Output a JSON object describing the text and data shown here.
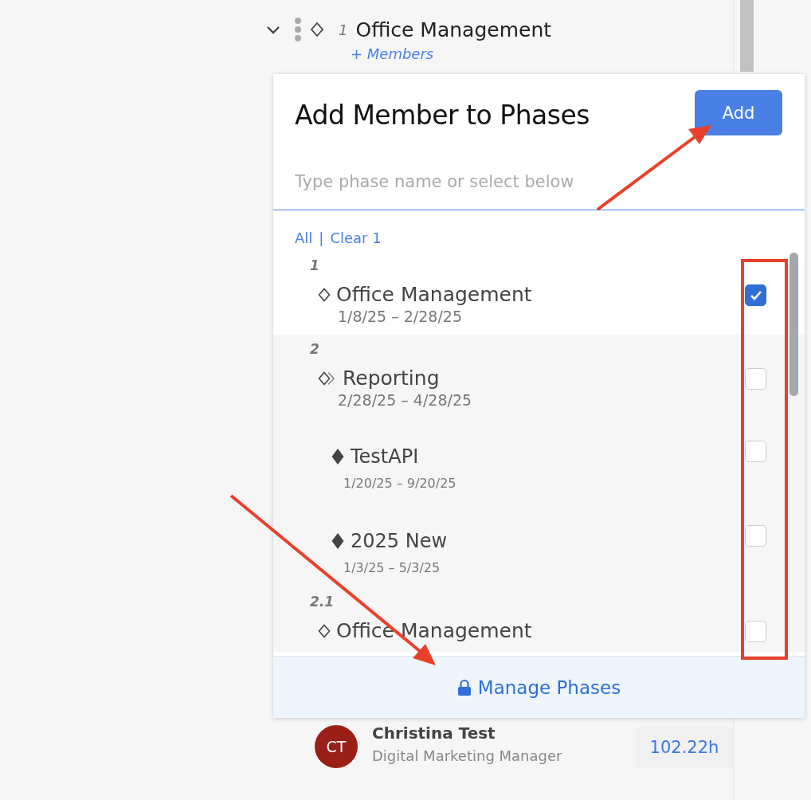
{
  "background_phase": {
    "number": "1",
    "name": "Office Management",
    "members_link": "+ Members",
    "expanded": true
  },
  "popover": {
    "title": "Add Member to Phases",
    "add_button": "Add",
    "search": {
      "placeholder": "Type phase name or select below"
    },
    "select_all": "All",
    "separator": "|",
    "clear": "Clear 1",
    "phases": [
      {
        "kind": "phase",
        "number": "1",
        "name": "Office Management",
        "dates": "1/8/25 – 2/28/25",
        "checked": true
      },
      {
        "kind": "phase_group",
        "number": "2",
        "name": "Reporting",
        "dates": "2/28/25 – 4/28/25",
        "checked": false
      },
      {
        "kind": "subphase",
        "name": "TestAPI",
        "dates": "1/20/25 – 9/20/25",
        "checked": false
      },
      {
        "kind": "subphase",
        "name": "2025 New",
        "dates": "1/3/25 – 5/3/25",
        "checked": false
      },
      {
        "kind": "phase",
        "number": "2.1",
        "name": "Office Management",
        "checked": false
      }
    ],
    "footer_link": "Manage Phases"
  },
  "member": {
    "initials": "CT",
    "color": "#9a1f17",
    "name": "Christina Test",
    "role": "Digital Marketing Manager",
    "hours": "102.22h"
  }
}
